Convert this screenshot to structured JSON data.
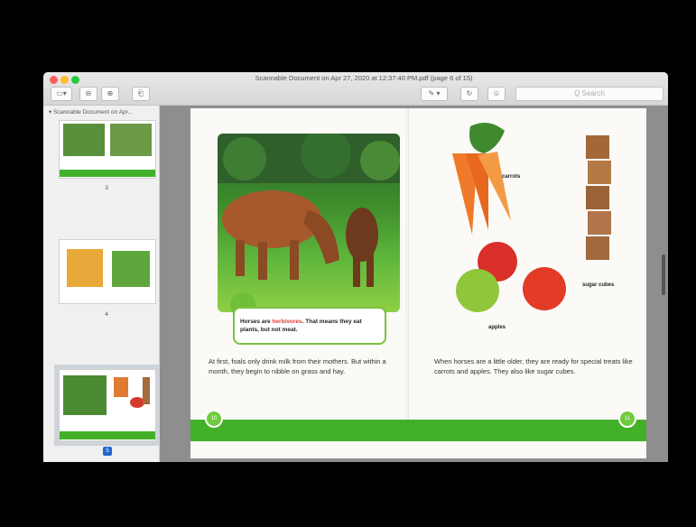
{
  "window": {
    "title": "Scannable Document on Apr 27, 2020 at 12:37:40 PM.pdf (page 6 of 15)"
  },
  "toolbar": {
    "sidebar_label": "▭▾",
    "zoom_out_label": "⊖",
    "zoom_in_label": "⊕",
    "share_label": "⎗",
    "markup_label": "✎ ▾",
    "rotate_label": "↻",
    "annotate_label": "☺",
    "search_placeholder": "Q Search"
  },
  "sidebar": {
    "title": "▾ Scannable Document on Apr...",
    "pages": [
      {
        "number": "3"
      },
      {
        "number": "4"
      },
      {
        "number": "5",
        "selected": true
      }
    ]
  },
  "page": {
    "callout": {
      "prefix": "Horses are ",
      "highlight": "herbivores",
      "rest": ". That means they eat plants, but not meat."
    },
    "left_text": "At first, foals only drink milk from their mothers. But within a month, they begin to nibble on grass and hay.",
    "right_text": "When horses are a little older, they are ready for special treats like carrots and apples. They also like sugar cubes.",
    "labels": {
      "carrots": "carrots",
      "sugar": "sugar cubes",
      "apples": "apples"
    },
    "left_page_number": "10",
    "right_page_number": "11"
  },
  "colors": {
    "accent_green": "#43b02a",
    "selection_blue": "#1f66d1"
  }
}
